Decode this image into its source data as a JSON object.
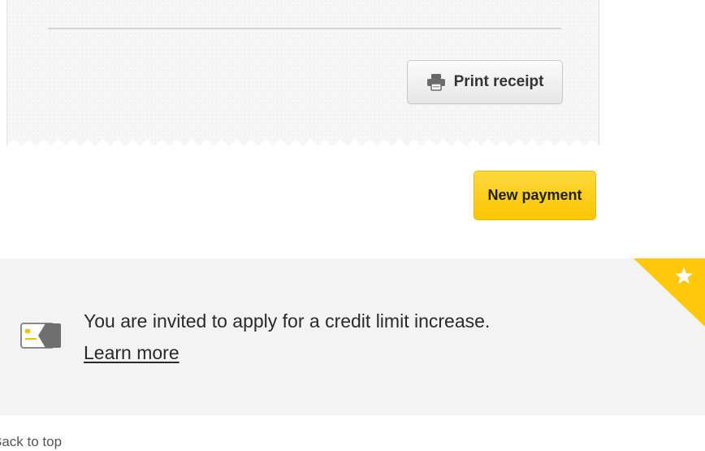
{
  "receipt": {
    "print_label": "Print receipt"
  },
  "actions": {
    "new_payment_label": "New payment"
  },
  "promo": {
    "message": "You are invited to apply for a credit limit increase.",
    "link_label": "Learn more",
    "corner_icon": "star-icon",
    "card_icon": "credit-card-icon",
    "accent_color": "#ffc80a"
  },
  "footer": {
    "back_to_top_label": "Back to top"
  },
  "colors": {
    "primary_button": "#fbc500",
    "banner_background": "#f3f3f3"
  }
}
